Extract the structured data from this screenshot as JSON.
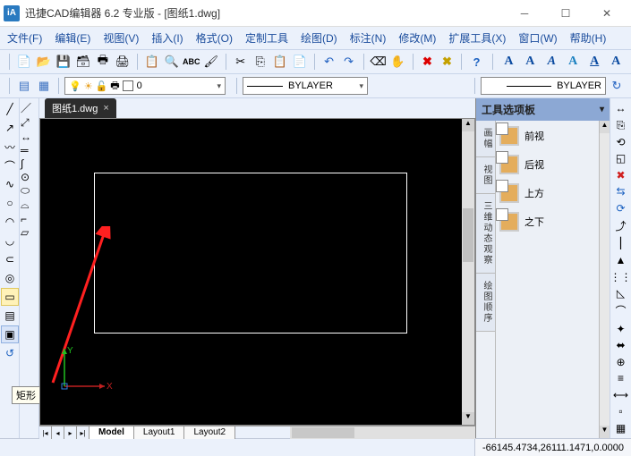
{
  "window": {
    "title": "迅捷CAD编辑器 6.2 专业版  -  [图纸1.dwg]",
    "app_icon_text": "iA"
  },
  "menu": {
    "items": [
      "文件(F)",
      "编辑(E)",
      "视图(V)",
      "插入(I)",
      "格式(O)",
      "定制工具",
      "绘图(D)",
      "标注(N)",
      "修改(M)",
      "扩展工具(X)",
      "窗口(W)",
      "帮助(H)"
    ]
  },
  "toolbar_main": {
    "icons": [
      "new",
      "open",
      "save",
      "saveall",
      "print",
      "printpreview",
      "plot",
      "find",
      "spellcheck",
      "paint",
      "cut",
      "copy",
      "paste",
      "clipboard",
      "undo",
      "redo",
      "erase",
      "pan",
      "delete-x",
      "refresh-x",
      "help"
    ]
  },
  "font_toolbar": {
    "letters": [
      "A",
      "A",
      "A",
      "A",
      "A",
      "A"
    ]
  },
  "layer_toolbar": {
    "sun_icon": "layer-state",
    "snow_icon": "freeze",
    "bulb": "on",
    "layer_dropdown_value": "0",
    "linetype_label": "BYLAYER",
    "lineweight_label": "BYLAYER"
  },
  "document": {
    "tab_label": "图纸1.dwg"
  },
  "left_tools_1": [
    "line",
    "arc",
    "polyline",
    "rectangle-alt",
    "circle",
    "ellipse",
    "arc2",
    "arc3",
    "hatch",
    "point",
    "rect",
    "text",
    "region",
    "revcloud"
  ],
  "left_tools_2": [
    "line2",
    "ray",
    "xline",
    "mline",
    "spline",
    "circle2",
    "donut",
    "arc4",
    "pline2",
    "boundary"
  ],
  "tooltip_text": "矩形",
  "layout": {
    "tabs": [
      "Model",
      "Layout1",
      "Layout2"
    ]
  },
  "palette": {
    "title": "工具选项板",
    "side_tabs": [
      "画幅",
      "视图",
      "三维动态观察",
      "绘图顺序"
    ],
    "items": [
      {
        "label": "前视"
      },
      {
        "label": "后视"
      },
      {
        "label": "上方"
      },
      {
        "label": "之下"
      }
    ]
  },
  "right_tools": [
    "move",
    "copy",
    "rotate",
    "scale",
    "mirror",
    "array",
    "offset",
    "trim",
    "extend",
    "break",
    "chamfer",
    "fillet",
    "explode",
    "join",
    "align",
    "stretch",
    "lengthen",
    "grips",
    "measure",
    "properties"
  ],
  "status": {
    "coords": "-66145.4734,26111.1471,0.0000"
  }
}
